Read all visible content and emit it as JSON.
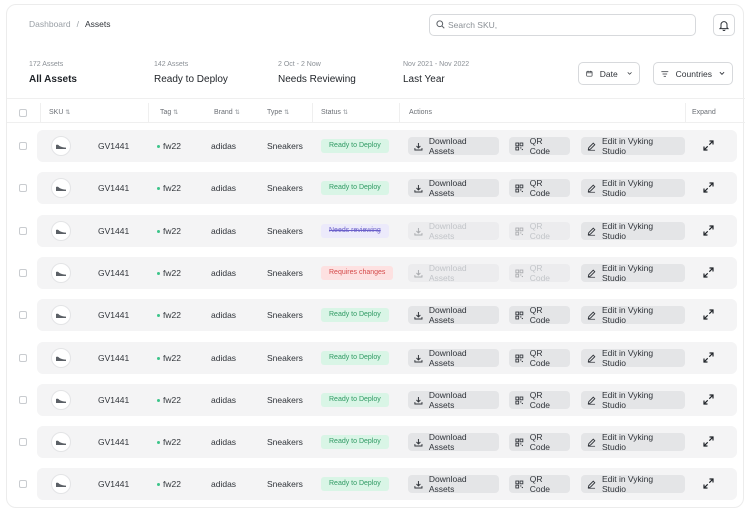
{
  "breadcrumb": {
    "root": "Dashboard",
    "separator": "/",
    "current": "Assets"
  },
  "search": {
    "placeholder": "Search SKU,"
  },
  "tabs": [
    {
      "count": "172 Assets",
      "label": "All Assets",
      "active": true
    },
    {
      "count": "142 Assets",
      "label": "Ready to Deploy",
      "active": false
    },
    {
      "count": "2 Oct - 2 Now",
      "label": "Needs Reviewing",
      "active": false
    },
    {
      "count": "Nov 2021 - Nov 2022",
      "label": "Last Year",
      "active": false
    }
  ],
  "filters": {
    "date_label": "Date",
    "countries_label": "Countries"
  },
  "columns": {
    "sku": "SKU",
    "tag": "Tag",
    "brand": "Brand",
    "type": "Type",
    "status": "Status",
    "actions": "Actions",
    "expand": "Expand"
  },
  "actions": {
    "download": "Download Assets",
    "qr": "QR Code",
    "edit": "Edit in Vyking Studio"
  },
  "rows": [
    {
      "sku": "GV1441",
      "tag": "fw22",
      "brand": "adidas",
      "type": "Sneakers",
      "status": "Ready to Deploy",
      "status_kind": "ready",
      "enabled": true
    },
    {
      "sku": "GV1441",
      "tag": "fw22",
      "brand": "adidas",
      "type": "Sneakers",
      "status": "Ready to Deploy",
      "status_kind": "ready",
      "enabled": true
    },
    {
      "sku": "GV1441",
      "tag": "fw22",
      "brand": "adidas",
      "type": "Sneakers",
      "status": "Needs reviewing",
      "status_kind": "review",
      "enabled": false
    },
    {
      "sku": "GV1441",
      "tag": "fw22",
      "brand": "adidas",
      "type": "Sneakers",
      "status": "Requires changes",
      "status_kind": "changes",
      "enabled": false
    },
    {
      "sku": "GV1441",
      "tag": "fw22",
      "brand": "adidas",
      "type": "Sneakers",
      "status": "Ready to Deploy",
      "status_kind": "ready",
      "enabled": true
    },
    {
      "sku": "GV1441",
      "tag": "fw22",
      "brand": "adidas",
      "type": "Sneakers",
      "status": "Ready to Deploy",
      "status_kind": "ready",
      "enabled": true
    },
    {
      "sku": "GV1441",
      "tag": "fw22",
      "brand": "adidas",
      "type": "Sneakers",
      "status": "Ready to Deploy",
      "status_kind": "ready",
      "enabled": true
    },
    {
      "sku": "GV1441",
      "tag": "fw22",
      "brand": "adidas",
      "type": "Sneakers",
      "status": "Ready to Deploy",
      "status_kind": "ready",
      "enabled": true
    },
    {
      "sku": "GV1441",
      "tag": "fw22",
      "brand": "adidas",
      "type": "Sneakers",
      "status": "Ready to Deploy",
      "status_kind": "ready",
      "enabled": true
    }
  ],
  "icons": {
    "search": "search-icon",
    "bell": "bell-icon",
    "calendar": "calendar-icon",
    "filter": "filter-icon",
    "download": "download-icon",
    "qr": "qr-code-icon",
    "edit": "pencil-icon",
    "expand": "expand-icon",
    "sort": "sort-icon",
    "shoe": "sneaker-icon"
  },
  "colors": {
    "ready_bg": "#d9f5e6",
    "ready_fg": "#2f9a63",
    "review_bg": "#eceafb",
    "review_fg": "#6a5fc9",
    "changes_bg": "#fde1e1",
    "changes_fg": "#d44a4a",
    "tag_dot": "#3cc48a"
  }
}
